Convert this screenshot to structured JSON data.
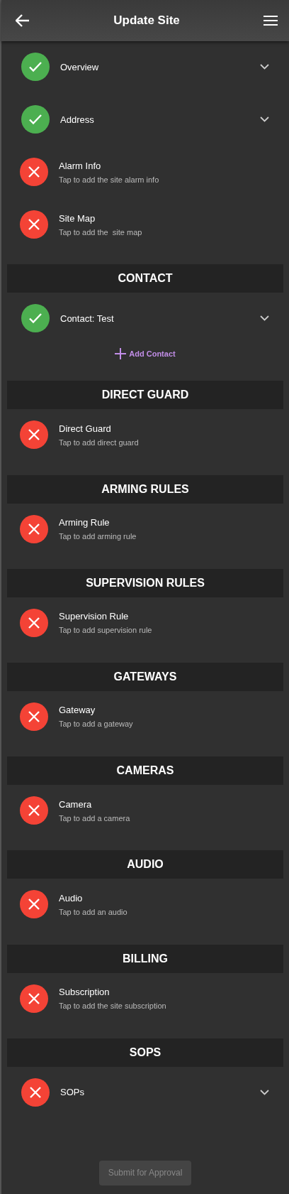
{
  "app_bar": {
    "title": "Update Site"
  },
  "sections": [
    {
      "items": [
        {
          "kind": "expandable",
          "done": true,
          "title": "Overview"
        },
        {
          "kind": "expandable",
          "done": true,
          "title": "Address"
        },
        {
          "kind": "action",
          "done": false,
          "title": "Alarm Info",
          "subtitle": "Tap to add the site alarm info"
        },
        {
          "kind": "action",
          "done": false,
          "title": "Site Map",
          "subtitle": "Tap to add the  site map"
        }
      ]
    },
    {
      "heading": "CONTACT",
      "items": [
        {
          "kind": "expandable",
          "done": true,
          "title": "Contact: Test"
        }
      ],
      "add_link": "Add Contact"
    },
    {
      "heading": "DIRECT GUARD",
      "items": [
        {
          "kind": "action",
          "done": false,
          "title": "Direct Guard",
          "subtitle": "Tap to add direct guard"
        }
      ]
    },
    {
      "heading": "ARMING RULES",
      "items": [
        {
          "kind": "action",
          "done": false,
          "title": "Arming Rule",
          "subtitle": "Tap to add arming rule"
        }
      ]
    },
    {
      "heading": "SUPERVISION RULES",
      "items": [
        {
          "kind": "action",
          "done": false,
          "title": "Supervision Rule",
          "subtitle": "Tap to add supervision rule"
        }
      ]
    },
    {
      "heading": "GATEWAYS",
      "items": [
        {
          "kind": "action",
          "done": false,
          "title": "Gateway",
          "subtitle": "Tap to add a gateway"
        }
      ]
    },
    {
      "heading": "CAMERAS",
      "items": [
        {
          "kind": "action",
          "done": false,
          "title": "Camera",
          "subtitle": "Tap to add a camera"
        }
      ]
    },
    {
      "heading": "AUDIO",
      "items": [
        {
          "kind": "action",
          "done": false,
          "title": "Audio",
          "subtitle": "Tap to add an audio"
        }
      ]
    },
    {
      "heading": "BILLING",
      "items": [
        {
          "kind": "action",
          "done": false,
          "title": "Subscription",
          "subtitle": "Tap to add the site subscription"
        }
      ]
    },
    {
      "heading": "SOPS",
      "items": [
        {
          "kind": "expandable",
          "done": false,
          "title": "SOPs"
        }
      ]
    }
  ],
  "submit_button": {
    "label": "Submit for Approval",
    "disabled": true
  }
}
